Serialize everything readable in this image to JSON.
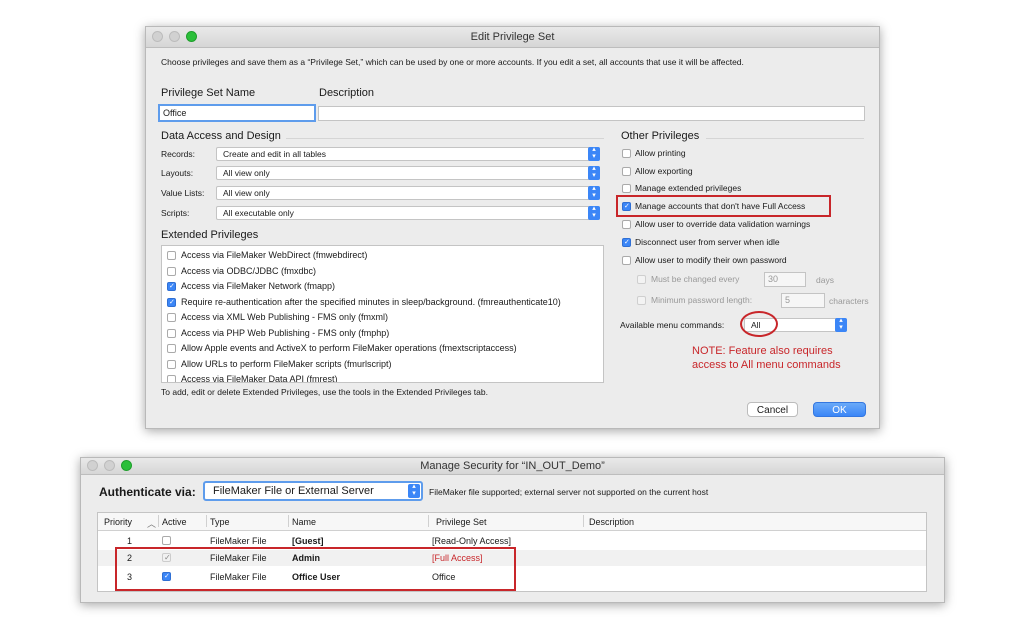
{
  "edit_dialog": {
    "title": "Edit Privilege Set",
    "intro": "Choose privileges and save them as a “Privilege Set,” which can be used by one or more accounts. If you edit a set, all accounts that use it will be affected.",
    "name_label": "Privilege Set Name",
    "name_value": "Office",
    "description_label": "Description",
    "description_value": "",
    "data_access_heading": "Data Access and Design",
    "records_label": "Records:",
    "records_value": "Create and edit in all tables",
    "layouts_label": "Layouts:",
    "layouts_value": "All view only",
    "value_lists_label": "Value Lists:",
    "value_lists_value": "All view only",
    "scripts_label": "Scripts:",
    "scripts_value": "All executable only",
    "extended_heading": "Extended Privileges",
    "extended": [
      {
        "label": "Access via FileMaker WebDirect (fmwebdirect)",
        "checked": false
      },
      {
        "label": "Access via ODBC/JDBC (fmxdbc)",
        "checked": false
      },
      {
        "label": "Access via FileMaker Network (fmapp)",
        "checked": true
      },
      {
        "label": "Require re-authentication after the specified minutes in sleep/background. (fmreauthenticate10)",
        "checked": true
      },
      {
        "label": "Access via XML Web Publishing - FMS only (fmxml)",
        "checked": false
      },
      {
        "label": "Access via PHP Web Publishing - FMS only (fmphp)",
        "checked": false
      },
      {
        "label": "Allow Apple events and ActiveX to perform FileMaker operations (fmextscriptaccess)",
        "checked": false
      },
      {
        "label": "Allow URLs to perform FileMaker scripts (fmurlscript)",
        "checked": false
      },
      {
        "label": "Access via FileMaker Data API (fmrest)",
        "checked": false
      }
    ],
    "extended_note": "To add, edit or delete Extended Privileges, use the tools in the Extended Privileges tab.",
    "other_heading": "Other Privileges",
    "other": [
      {
        "label": "Allow printing",
        "checked": false
      },
      {
        "label": "Allow exporting",
        "checked": false
      },
      {
        "label": "Manage extended privileges",
        "checked": false
      },
      {
        "label": "Manage accounts that don't have Full Access",
        "checked": true
      },
      {
        "label": "Allow user to override data validation warnings",
        "checked": false
      },
      {
        "label": "Disconnect user from server when idle",
        "checked": true
      },
      {
        "label": "Allow user to modify their own password",
        "checked": false
      }
    ],
    "must_change_label": "Must be changed every",
    "must_change_value": "30",
    "days_label": "days",
    "min_length_label": "Minimum password length:",
    "min_length_value": "5",
    "characters_label": "characters",
    "menu_commands_label": "Available menu commands:",
    "menu_commands_value": "All",
    "note_line1": "NOTE: Feature also requires",
    "note_line2": "access to All menu commands",
    "cancel_label": "Cancel",
    "ok_label": "OK"
  },
  "security_window": {
    "title": "Manage Security for “IN_OUT_Demo”",
    "authenticate_label": "Authenticate via:",
    "authenticate_value": "FileMaker File or External Server",
    "authenticate_note": "FileMaker file supported; external server not supported on the current host",
    "columns": [
      "Priority",
      "Active",
      "Type",
      "Name",
      "Privilege Set",
      "Description"
    ],
    "rows": [
      {
        "priority": "1",
        "type": "FileMaker File",
        "name": "[Guest]",
        "privilege": "[Read-Only Access]",
        "active": "off"
      },
      {
        "priority": "2",
        "type": "FileMaker File",
        "name": "Admin",
        "privilege": "[Full Access]",
        "active": "gray"
      },
      {
        "priority": "3",
        "type": "FileMaker File",
        "name": "Office User",
        "privilege": "Office",
        "active": "on"
      }
    ]
  },
  "colors": {
    "accent": "#3b86f7",
    "annotation_red": "#c8262a",
    "full_access_red": "#c8262a"
  }
}
